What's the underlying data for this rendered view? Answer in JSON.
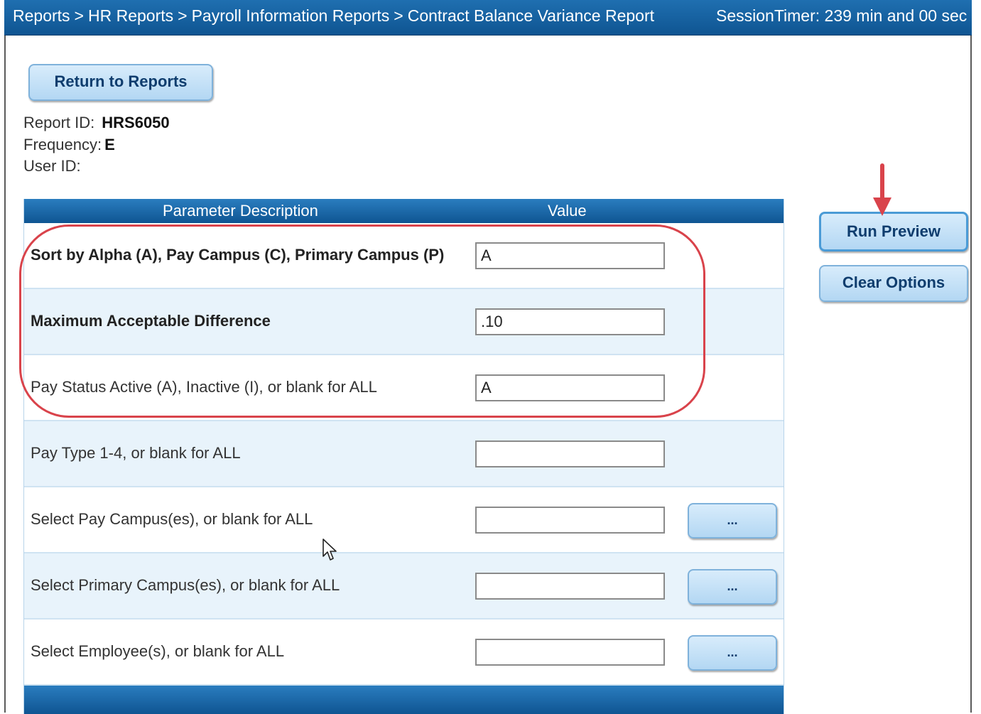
{
  "breadcrumb": {
    "items": [
      "Reports",
      "HR Reports",
      "Payroll Information Reports",
      "Contract Balance Variance Report"
    ],
    "separator": ">"
  },
  "session_timer": "SessionTimer: 239 min and 00 sec",
  "buttons": {
    "return": "Return to Reports",
    "run_preview": "Run Preview",
    "clear_options": "Clear Options",
    "ellipsis": "..."
  },
  "report_info": {
    "report_id_label": "Report ID:",
    "report_id_value": "HRS6050",
    "frequency_label": "Frequency:",
    "frequency_value": "E",
    "user_id_label": "User ID:",
    "user_id_value": ""
  },
  "table": {
    "headers": [
      "Parameter Description",
      "Value"
    ],
    "rows": [
      {
        "label": "Sort by Alpha (A), Pay Campus (C), Primary Campus (P)",
        "value": "A"
      },
      {
        "label": "Maximum Acceptable Difference",
        "value": ".10"
      },
      {
        "label": "Pay Status Active (A), Inactive (I), or blank for ALL",
        "value": "A"
      },
      {
        "label": "Pay Type 1-4, or blank for ALL",
        "value": ""
      },
      {
        "label": "Select Pay Campus(es), or blank for ALL",
        "value": ""
      },
      {
        "label": "Select Primary Campus(es), or blank for ALL",
        "value": ""
      },
      {
        "label": "Select Employee(s), or blank for ALL",
        "value": ""
      }
    ]
  },
  "colors": {
    "header_blue": "#0f5592",
    "button_bg": "#b3d7f3",
    "annotation_red": "#d9434b",
    "row_alt": "#e8f3fb"
  }
}
